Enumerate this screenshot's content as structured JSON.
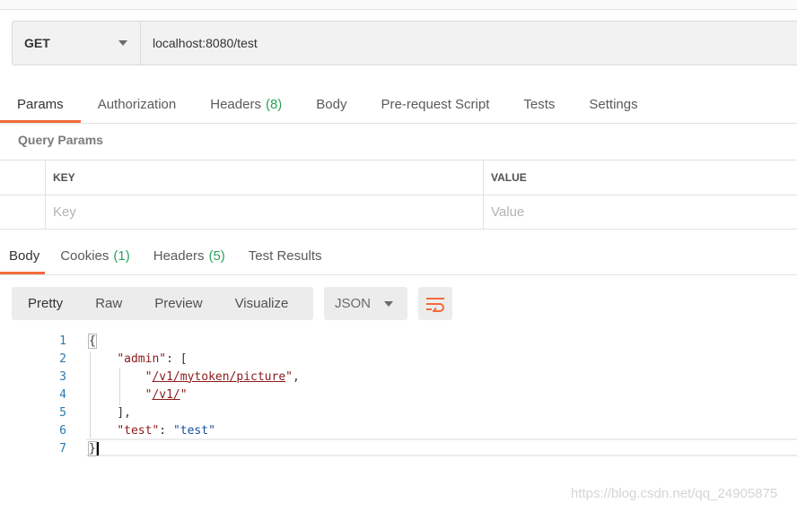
{
  "request": {
    "method": "GET",
    "url": "localhost:8080/test"
  },
  "request_tabs": [
    {
      "label": "Params",
      "count": ""
    },
    {
      "label": "Authorization",
      "count": ""
    },
    {
      "label": "Headers",
      "count": "(8)"
    },
    {
      "label": "Body",
      "count": ""
    },
    {
      "label": "Pre-request Script",
      "count": ""
    },
    {
      "label": "Tests",
      "count": ""
    },
    {
      "label": "Settings",
      "count": ""
    }
  ],
  "query_params": {
    "title": "Query Params",
    "col_key": "KEY",
    "col_value": "VALUE",
    "key_placeholder": "Key",
    "value_placeholder": "Value"
  },
  "response_tabs": [
    {
      "label": "Body",
      "count": ""
    },
    {
      "label": "Cookies",
      "count": "(1)"
    },
    {
      "label": "Headers",
      "count": "(5)"
    },
    {
      "label": "Test Results",
      "count": ""
    }
  ],
  "view_modes": [
    "Pretty",
    "Raw",
    "Preview",
    "Visualize"
  ],
  "format": "JSON",
  "code": {
    "line_numbers": [
      "1",
      "2",
      "3",
      "4",
      "5",
      "6",
      "7"
    ],
    "l1": "{",
    "l2_key": "\"admin\"",
    "l2_rest": ": [",
    "l3_link": "/v1/mytoken/picture",
    "l4_link": "/v1/",
    "l5": "],",
    "l6_key": "\"test\"",
    "l6_val": "\"test\"",
    "l7": "}"
  },
  "watermark": "https://blog.csdn.net/qq_24905875",
  "colors": {
    "accent": "#f26b3a",
    "count_green": "#2aa35a"
  }
}
